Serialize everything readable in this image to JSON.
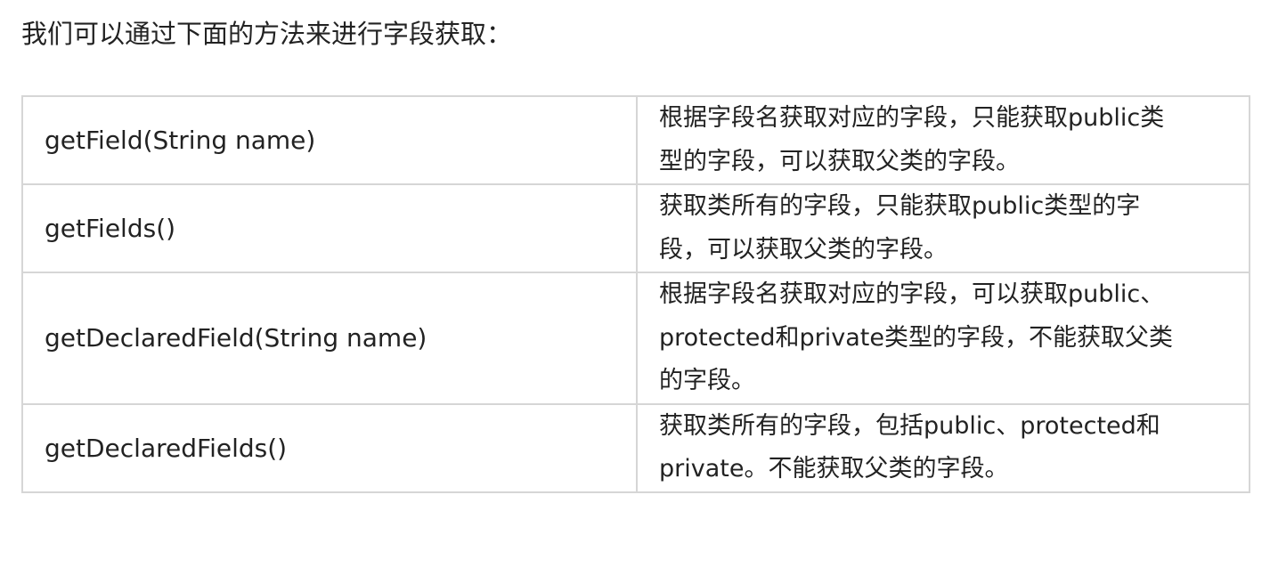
{
  "intro": "我们可以通过下面的方法来进行字段获取：",
  "rows": [
    {
      "method": "getField(String name)",
      "desc_lines": [
        "根据字段名获取对应的字段，只能获取public类",
        "型的字段，可以获取父类的字段。"
      ]
    },
    {
      "method": "getFields()",
      "desc_lines": [
        "获取类所有的字段，只能获取public类型的字",
        "段，可以获取父类的字段。"
      ]
    },
    {
      "method": "getDeclaredField(String name)",
      "desc_lines": [
        "根据字段名获取对应的字段，可以获取public、",
        "protected和private类型的字段，不能获取父类",
        "的字段。"
      ]
    },
    {
      "method": "getDeclaredFields()",
      "desc_lines": [
        "获取类所有的字段，包括public、protected和",
        "private。不能获取父类的字段。"
      ]
    }
  ]
}
